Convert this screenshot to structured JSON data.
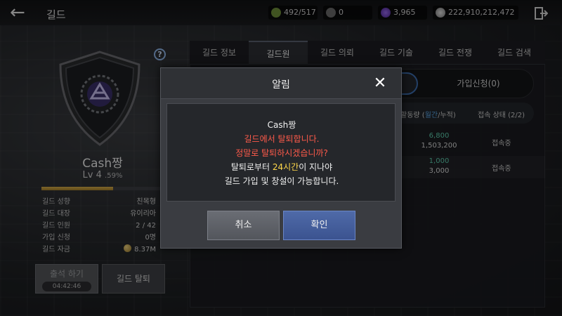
{
  "header": {
    "title": "길드",
    "resources": [
      {
        "icon": "stamina-icon",
        "value": "492/517",
        "color": "#7fa040"
      },
      {
        "icon": "coin-icon",
        "value": "0",
        "color": "#777777"
      },
      {
        "icon": "purple-gem-icon",
        "value": "3,965",
        "color": "#7a45c4"
      },
      {
        "icon": "silver-icon",
        "value": "222,910,212,472",
        "color": "#a8a8a8"
      }
    ]
  },
  "guild": {
    "name": "Cash짱",
    "level": "Lv 4",
    "level_pct": ".59%",
    "exp_fraction": 0.59,
    "info": [
      {
        "key": "길드 성향",
        "value": "친목형"
      },
      {
        "key": "길드 대장",
        "value": "유이리아"
      },
      {
        "key": "길드 인원",
        "value": "2 / 42"
      },
      {
        "key": "가입 신청",
        "value": "0명"
      },
      {
        "key": "길드 자금",
        "value": "8.37M"
      }
    ],
    "attend_label": "출석 하기",
    "attend_time": "04:42:46",
    "leave_label": "길드 탈퇴"
  },
  "tabs": [
    "길드 정보",
    "길드원",
    "길드 의뢰",
    "길드 기술",
    "길드 전쟁",
    "길드 검색"
  ],
  "active_tab": 1,
  "segment": {
    "right_label": "가입신청(0)"
  },
  "table": {
    "header_activity_prefix": "활동량 (",
    "header_activity_hl": "월간",
    "header_activity_suffix": "/누적)",
    "header_status": "접속 상태 (2/2)",
    "rows": [
      {
        "monthly": "6,800",
        "total": "1,503,200",
        "status": "접속중",
        "monthly_color": "#5fd0b0"
      },
      {
        "monthly": "1,000",
        "total": "3,000",
        "status": "접속중",
        "monthly_color": "#5fd0b0"
      }
    ]
  },
  "modal": {
    "title": "알림",
    "line1": "Cash짱",
    "line2": "길드에서 탈퇴합니다.",
    "line3": "정말로 탈퇴하시겠습니까?",
    "line4_pre": "탈퇴로부터 ",
    "line4_hl": "24시간",
    "line4_post": "이 지나야",
    "line5": "길드 가입 및 창설이 가능합니다.",
    "cancel_label": "취소",
    "ok_label": "확인"
  }
}
